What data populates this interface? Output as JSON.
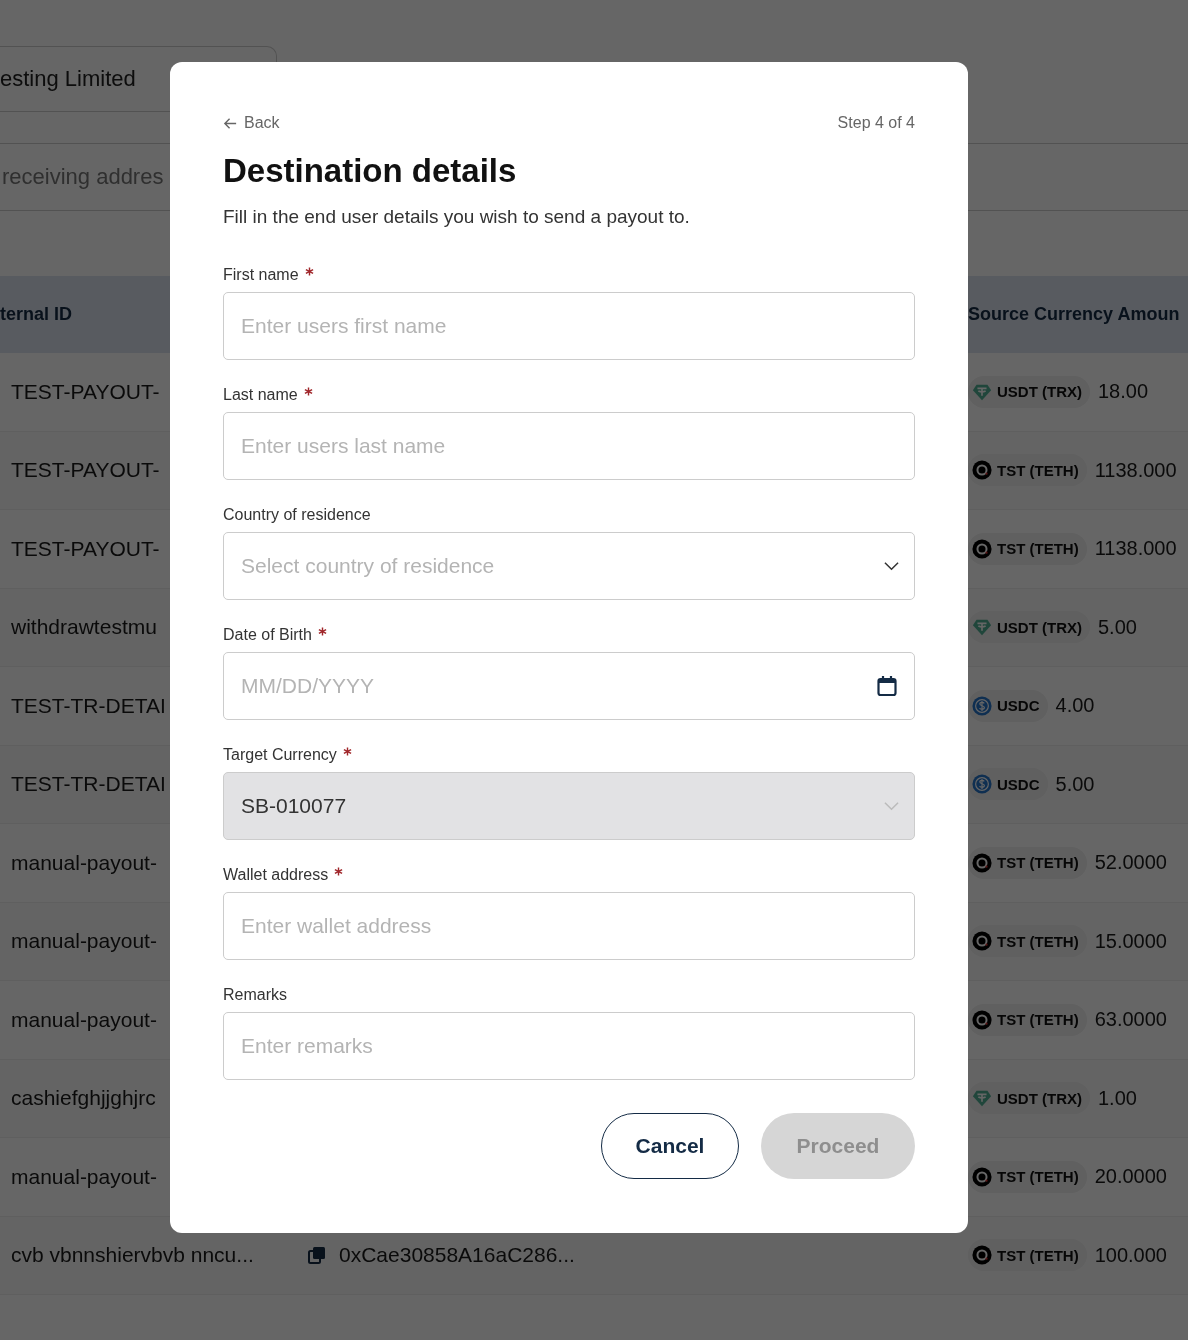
{
  "background": {
    "company_field": {
      "value": "esting Limited"
    },
    "address_field": {
      "placeholder": "receiving addres"
    },
    "table": {
      "columns": [
        "ternal ID",
        "Source Currency Amoun"
      ],
      "rows": [
        {
          "external_id": "TEST-PAYOUT-",
          "currency": "USDT (TRX)",
          "kind": "usdt",
          "amount": "18.00"
        },
        {
          "external_id": "TEST-PAYOUT-",
          "currency": "TST (TETH)",
          "kind": "tst",
          "amount": "1138.000"
        },
        {
          "external_id": "TEST-PAYOUT-",
          "currency": "TST (TETH)",
          "kind": "tst",
          "amount": "1138.000"
        },
        {
          "external_id": "withdrawtestmu",
          "currency": "USDT (TRX)",
          "kind": "usdt",
          "amount": "5.00"
        },
        {
          "external_id": "TEST-TR-DETAI",
          "currency": "USDC",
          "kind": "usdc",
          "amount": "4.00"
        },
        {
          "external_id": "TEST-TR-DETAI",
          "currency": "USDC",
          "kind": "usdc",
          "amount": "5.00"
        },
        {
          "external_id": "manual-payout-",
          "currency": "TST (TETH)",
          "kind": "tst",
          "amount": "52.0000"
        },
        {
          "external_id": "manual-payout-",
          "currency": "TST (TETH)",
          "kind": "tst",
          "amount": "15.0000"
        },
        {
          "external_id": "manual-payout-",
          "currency": "TST (TETH)",
          "kind": "tst",
          "amount": "63.0000"
        },
        {
          "external_id": "cashiefghjjghjrc",
          "currency": "USDT (TRX)",
          "kind": "usdt",
          "amount": "1.00"
        },
        {
          "external_id": "manual-payout-",
          "currency": "TST (TETH)",
          "kind": "tst",
          "amount": "20.0000"
        },
        {
          "external_id": "cvb vbnnshiervbvb nncu...",
          "address": "0xCae30858A16aC286...",
          "currency": "TST (TETH)",
          "kind": "tst",
          "amount": "100.000"
        }
      ]
    }
  },
  "dialog": {
    "back": "Back",
    "step": "Step 4 of 4",
    "title": "Destination details",
    "subtitle": "Fill in the end user details you wish to send a payout to.",
    "fields": [
      {
        "label": "First name",
        "required": true,
        "kind": "text",
        "placeholder": "Enter users first name",
        "disabled": false
      },
      {
        "label": "Last name",
        "required": true,
        "kind": "text",
        "placeholder": "Enter users last name",
        "disabled": false
      },
      {
        "label": "Country of residence",
        "required": false,
        "kind": "select",
        "placeholder": "Select country of residence",
        "disabled": false
      },
      {
        "label": "Date of Birth",
        "required": true,
        "kind": "date",
        "placeholder": "MM/DD/YYYY",
        "disabled": false
      },
      {
        "label": "Target Currency",
        "required": true,
        "kind": "select",
        "value": "SB-010077",
        "disabled": true
      },
      {
        "label": "Wallet address",
        "required": true,
        "kind": "text",
        "placeholder": "Enter wallet address",
        "disabled": false
      },
      {
        "label": "Remarks",
        "required": false,
        "kind": "text",
        "placeholder": "Enter remarks",
        "disabled": false
      }
    ],
    "buttons": [
      {
        "label": "Cancel",
        "kind": "secondary",
        "disabled": false
      },
      {
        "label": "Proceed",
        "kind": "primary",
        "disabled": true
      }
    ]
  }
}
